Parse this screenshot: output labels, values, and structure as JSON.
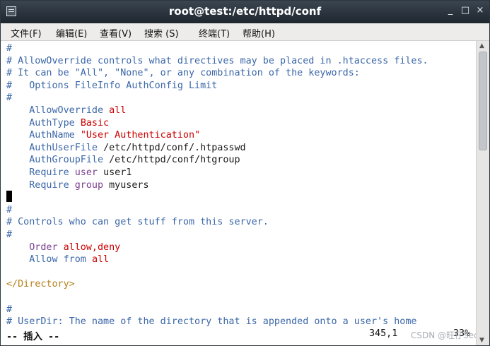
{
  "window": {
    "title": "root@test:/etc/httpd/conf",
    "icon": "terminal-icon",
    "controls": {
      "minimize": "_",
      "maximize": "□",
      "close": "×"
    }
  },
  "menu": [
    "文件(F)",
    "编辑(E)",
    "查看(V)",
    "搜索 (S)",
    "终端(T)",
    "帮助(H)"
  ],
  "terminal": {
    "lines": [
      [
        {
          "t": "#",
          "c": "cmt"
        }
      ],
      [
        {
          "t": "# AllowOverride controls what directives may be placed in .htaccess files.",
          "c": "cmt"
        }
      ],
      [
        {
          "t": "# It can be \"All\", \"None\", or any combination of the keywords:",
          "c": "cmt"
        }
      ],
      [
        {
          "t": "#   Options FileInfo AuthConfig Limit",
          "c": "cmt"
        }
      ],
      [
        {
          "t": "#",
          "c": "cmt"
        }
      ],
      [
        {
          "t": "    AllowOverride ",
          "c": "kw"
        },
        {
          "t": "all",
          "c": "red"
        }
      ],
      [
        {
          "t": "    AuthType ",
          "c": "kw"
        },
        {
          "t": "Basic",
          "c": "red"
        }
      ],
      [
        {
          "t": "    AuthName ",
          "c": "kw"
        },
        {
          "t": "\"User Authentication\"",
          "c": "red"
        }
      ],
      [
        {
          "t": "    AuthUserFile ",
          "c": "kw"
        },
        {
          "t": "/etc/httpd/conf/.htpasswd",
          "c": "plain"
        }
      ],
      [
        {
          "t": "    AuthGroupFile ",
          "c": "kw"
        },
        {
          "t": "/etc/httpd/conf/htgroup",
          "c": "plain"
        }
      ],
      [
        {
          "t": "    Require ",
          "c": "kw"
        },
        {
          "t": "user ",
          "c": "pur"
        },
        {
          "t": "user1",
          "c": "plain"
        }
      ],
      [
        {
          "t": "    Require ",
          "c": "kw"
        },
        {
          "t": "group ",
          "c": "pur"
        },
        {
          "t": "myusers",
          "c": "plain"
        }
      ],
      [
        {
          "t": "",
          "c": "plain"
        }
      ],
      [
        {
          "t": "#",
          "c": "cmt"
        }
      ],
      [
        {
          "t": "# Controls who can get stuff from this server.",
          "c": "cmt"
        }
      ],
      [
        {
          "t": "#",
          "c": "cmt"
        }
      ],
      [
        {
          "t": "    Order ",
          "c": "pur"
        },
        {
          "t": "allow,deny",
          "c": "red"
        }
      ],
      [
        {
          "t": "    Allow from ",
          "c": "kw"
        },
        {
          "t": "all",
          "c": "red"
        }
      ],
      [
        {
          "t": "",
          "c": "plain"
        }
      ],
      [
        {
          "t": "</Directory>",
          "c": "tag"
        }
      ],
      [
        {
          "t": "",
          "c": "plain"
        }
      ],
      [
        {
          "t": "#",
          "c": "cmt"
        }
      ],
      [
        {
          "t": "# UserDir: The name of the directory that is appended onto a user's home",
          "c": "cmt"
        }
      ]
    ],
    "status_mode": "-- 插入 --",
    "status_position": "345,1",
    "status_percent": "33%",
    "watermark": "CSDN @旺仔Sec"
  }
}
